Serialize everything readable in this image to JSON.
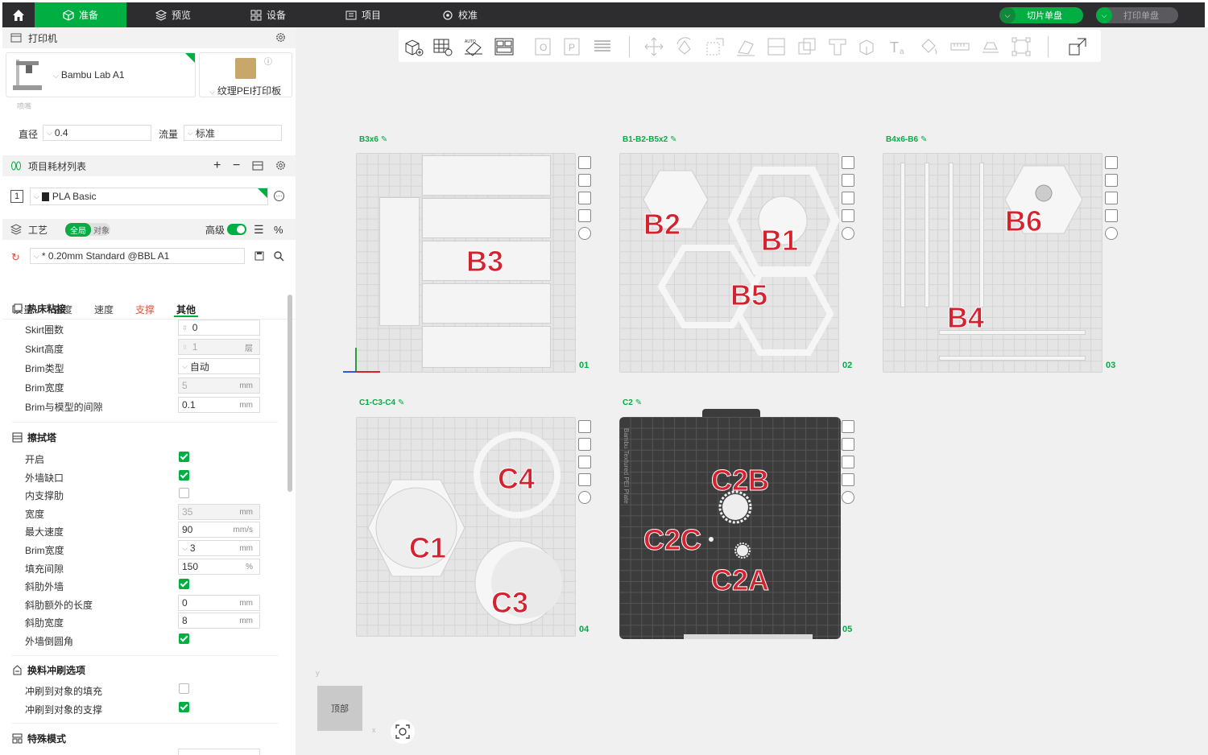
{
  "topbar": {
    "tabs": [
      {
        "label": "准备",
        "icon": "cube-icon"
      },
      {
        "label": "预览",
        "icon": "layers-icon"
      },
      {
        "label": "设备",
        "icon": "device-icon"
      },
      {
        "label": "项目",
        "icon": "project-icon"
      },
      {
        "label": "校准",
        "icon": "calibrate-icon"
      }
    ],
    "slice_button": "切片单盘",
    "print_button": "打印单盘",
    "accent": "#00ae42"
  },
  "printer": {
    "header": "打印机",
    "name": "Bambu Lab A1",
    "plate_type": "纹理PEI打印板",
    "nozzle_label": "喷嘴",
    "diameter_label": "直径",
    "diameter_value": "0.4",
    "flow_label": "流量",
    "flow_value": "标准"
  },
  "filament": {
    "header": "项目耗材列表",
    "slot": "1",
    "name": "PLA Basic"
  },
  "process": {
    "header": "工艺",
    "toggle_global": "全局",
    "toggle_object": "对象",
    "advanced_label": "高级",
    "preset": "* 0.20mm Standard @BBL A1",
    "subtabs": [
      "质量",
      "强度",
      "速度",
      "支撑",
      "其他"
    ],
    "active_subtab": "其他",
    "highlight_subtab": "支撑"
  },
  "bed_adhesion": {
    "title": "热床粘接",
    "rows": [
      {
        "label": "Skirt圈数",
        "value": "0",
        "unit": ""
      },
      {
        "label": "Skirt高度",
        "value": "1",
        "unit": "层"
      },
      {
        "label": "Brim类型",
        "value": "自动",
        "unit": ""
      },
      {
        "label": "Brim宽度",
        "value": "5",
        "unit": "mm"
      },
      {
        "label": "Brim与模型的间隙",
        "value": "0.1",
        "unit": "mm"
      }
    ]
  },
  "prime_tower": {
    "title": "擦拭塔",
    "rows": [
      {
        "label": "开启",
        "checked": true
      },
      {
        "label": "外墙缺口",
        "checked": true
      },
      {
        "label": "内支撑肋",
        "checked": false
      },
      {
        "label": "宽度",
        "value": "35",
        "unit": "mm"
      },
      {
        "label": "最大速度",
        "value": "90",
        "unit": "mm/s"
      },
      {
        "label": "Brim宽度",
        "value": "3",
        "unit": "mm"
      },
      {
        "label": "填充间隙",
        "value": "150",
        "unit": "%"
      },
      {
        "label": "斜肋外墙",
        "checked": true
      },
      {
        "label": "斜肋额外的长度",
        "value": "0",
        "unit": "mm"
      },
      {
        "label": "斜肋宽度",
        "value": "8",
        "unit": "mm"
      },
      {
        "label": "外墙倒圆角",
        "checked": true
      }
    ]
  },
  "flush": {
    "title": "换料冲刷选项",
    "rows": [
      {
        "label": "冲刷到对象的填充",
        "checked": false
      },
      {
        "label": "冲刷到对象的支撑",
        "checked": true
      }
    ]
  },
  "special": {
    "title": "特殊模式"
  },
  "plates": [
    {
      "name": "B3x6",
      "number": "01",
      "parts": [
        "B3"
      ]
    },
    {
      "name": "B1-B2-B5x2",
      "number": "02",
      "parts": [
        "B2",
        "B1",
        "B5"
      ]
    },
    {
      "name": "B4x6-B6",
      "number": "03",
      "parts": [
        "B6",
        "B4"
      ]
    },
    {
      "name": "C1-C3-C4",
      "number": "04",
      "parts": [
        "C4",
        "C1",
        "C3"
      ]
    },
    {
      "name": "C2",
      "number": "05",
      "parts": [
        "C2B",
        "C2C",
        "C2A"
      ],
      "plate_text": "Bambu Textured PEI Plate"
    }
  ],
  "view": {
    "viewcube_label": "顶部",
    "axis_y": "y",
    "axis_x": "x"
  }
}
